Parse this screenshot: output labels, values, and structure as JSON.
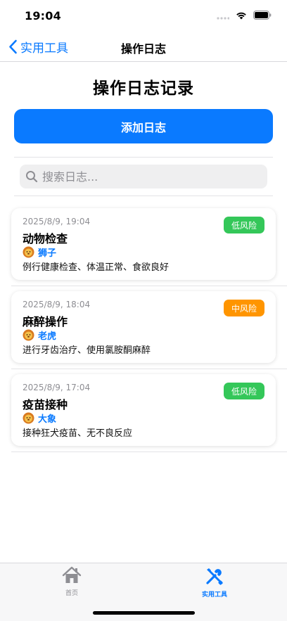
{
  "status_bar": {
    "time": "19:04"
  },
  "nav": {
    "back_label": "实用工具",
    "title": "操作日志"
  },
  "page": {
    "title": "操作日志记录"
  },
  "add_button": {
    "label": "添加日志"
  },
  "search": {
    "placeholder": "搜索日志..."
  },
  "logs": [
    {
      "time": "2025/8/9, 19:04",
      "title": "动物检查",
      "animal": "狮子",
      "animal_icon": "lion-emoji",
      "description": "例行健康检查、体温正常、食欲良好",
      "risk": "低风险",
      "risk_color": "#34c759"
    },
    {
      "time": "2025/8/9, 18:04",
      "title": "麻醉操作",
      "animal": "老虎",
      "animal_icon": "lion-emoji",
      "description": "进行牙齿治疗、使用氯胺酮麻醉",
      "risk": "中风险",
      "risk_color": "#ff9500"
    },
    {
      "time": "2025/8/9, 17:04",
      "title": "疫苗接种",
      "animal": "大象",
      "animal_icon": "lion-emoji",
      "description": "接种狂犬疫苗、无不良反应",
      "risk": "低风险",
      "risk_color": "#34c759"
    }
  ],
  "tab_bar": {
    "tabs": [
      {
        "label": "首页",
        "icon": "house-icon",
        "active": false
      },
      {
        "label": "实用工具",
        "icon": "tools-icon",
        "active": true
      }
    ]
  },
  "colors": {
    "accent": "#0a7aff",
    "low_risk": "#34c759",
    "medium_risk": "#ff9500",
    "inactive": "#8e8e93"
  }
}
